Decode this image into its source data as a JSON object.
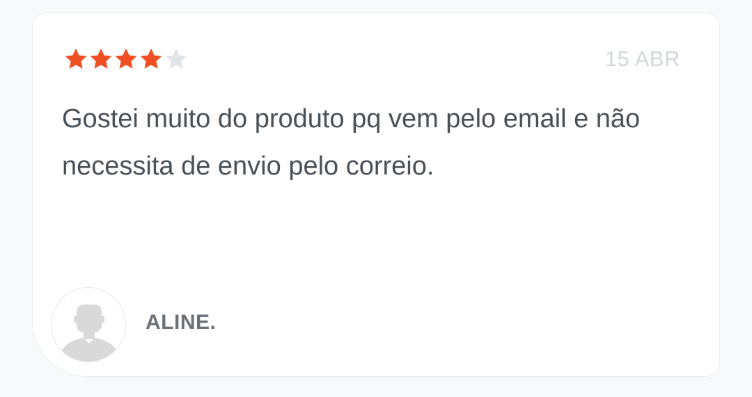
{
  "review": {
    "rating": 4,
    "max_rating": 5,
    "date": "15 ABR",
    "text": "Gostei muito do produto pq vem pelo email e não necessita de envio pelo correio.",
    "author": "ALINE."
  },
  "colors": {
    "star_filled": "#f04e23",
    "star_empty": "#e1e4e8",
    "text": "#4a5058",
    "date": "#d2d6db",
    "author": "#6b7079",
    "avatar_silhouette": "#d9d9d9"
  },
  "icons": {
    "star": "star-icon",
    "avatar": "user-silhouette-icon"
  }
}
